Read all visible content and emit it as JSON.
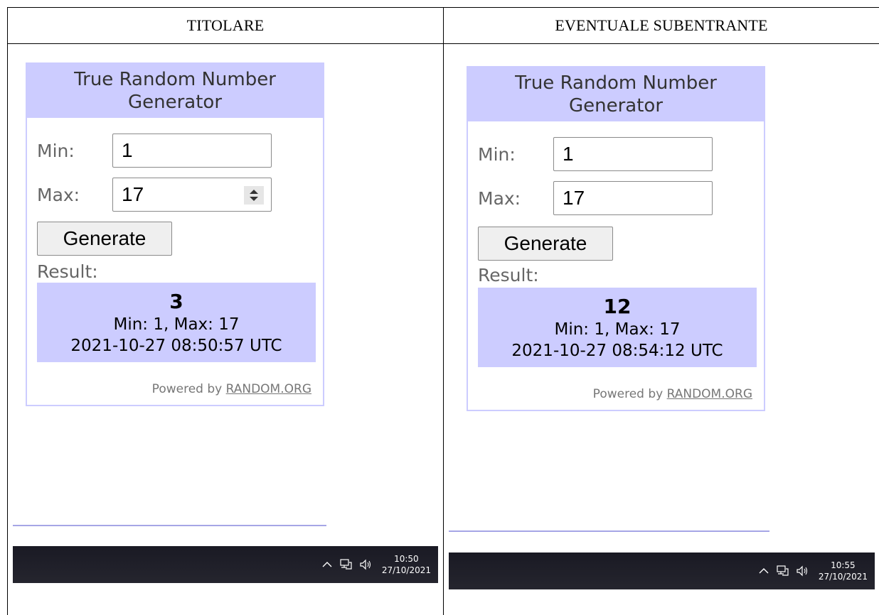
{
  "table": {
    "headers": [
      "TITOLARE",
      "EVENTUALE SUBENTRANTE"
    ]
  },
  "panels": [
    {
      "widget": {
        "title": "True Random Number Generator",
        "min_label": "Min:",
        "min_value": "1",
        "max_label": "Max:",
        "max_value": "17",
        "generate_label": "Generate",
        "result_label": "Result:",
        "result_number": "3",
        "result_range": "Min: 1, Max: 17",
        "result_timestamp": "2021-10-27 08:50:57 UTC",
        "powered_by": "Powered by",
        "powered_link": "RANDOM.ORG"
      },
      "taskbar": {
        "time": "10:50",
        "date": "27/10/2021"
      }
    },
    {
      "widget": {
        "title": "True Random Number Generator",
        "min_label": "Min:",
        "min_value": "1",
        "max_label": "Max:",
        "max_value": "17",
        "generate_label": "Generate",
        "result_label": "Result:",
        "result_number": "12",
        "result_range": "Min: 1, Max: 17",
        "result_timestamp": "2021-10-27 08:54:12 UTC",
        "powered_by": "Powered by",
        "powered_link": "RANDOM.ORG"
      },
      "taskbar": {
        "time": "10:55",
        "date": "27/10/2021"
      }
    }
  ],
  "colors": {
    "widget_accent": "#ccccff",
    "taskbar_bg": "#1f1f28",
    "divider": "#a6a6e6"
  },
  "icons": [
    "chevron-up-icon",
    "network-icon",
    "speaker-icon",
    "spinner-icon"
  ]
}
